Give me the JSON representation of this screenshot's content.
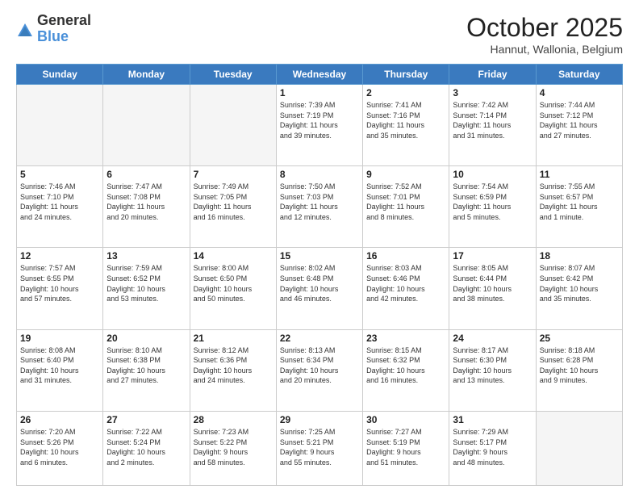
{
  "header": {
    "logo": {
      "general": "General",
      "blue": "Blue"
    },
    "title": "October 2025",
    "location": "Hannut, Wallonia, Belgium"
  },
  "weekdays": [
    "Sunday",
    "Monday",
    "Tuesday",
    "Wednesday",
    "Thursday",
    "Friday",
    "Saturday"
  ],
  "weeks": [
    [
      {
        "day": "",
        "info": ""
      },
      {
        "day": "",
        "info": ""
      },
      {
        "day": "",
        "info": ""
      },
      {
        "day": "1",
        "info": "Sunrise: 7:39 AM\nSunset: 7:19 PM\nDaylight: 11 hours\nand 39 minutes."
      },
      {
        "day": "2",
        "info": "Sunrise: 7:41 AM\nSunset: 7:16 PM\nDaylight: 11 hours\nand 35 minutes."
      },
      {
        "day": "3",
        "info": "Sunrise: 7:42 AM\nSunset: 7:14 PM\nDaylight: 11 hours\nand 31 minutes."
      },
      {
        "day": "4",
        "info": "Sunrise: 7:44 AM\nSunset: 7:12 PM\nDaylight: 11 hours\nand 27 minutes."
      }
    ],
    [
      {
        "day": "5",
        "info": "Sunrise: 7:46 AM\nSunset: 7:10 PM\nDaylight: 11 hours\nand 24 minutes."
      },
      {
        "day": "6",
        "info": "Sunrise: 7:47 AM\nSunset: 7:08 PM\nDaylight: 11 hours\nand 20 minutes."
      },
      {
        "day": "7",
        "info": "Sunrise: 7:49 AM\nSunset: 7:05 PM\nDaylight: 11 hours\nand 16 minutes."
      },
      {
        "day": "8",
        "info": "Sunrise: 7:50 AM\nSunset: 7:03 PM\nDaylight: 11 hours\nand 12 minutes."
      },
      {
        "day": "9",
        "info": "Sunrise: 7:52 AM\nSunset: 7:01 PM\nDaylight: 11 hours\nand 8 minutes."
      },
      {
        "day": "10",
        "info": "Sunrise: 7:54 AM\nSunset: 6:59 PM\nDaylight: 11 hours\nand 5 minutes."
      },
      {
        "day": "11",
        "info": "Sunrise: 7:55 AM\nSunset: 6:57 PM\nDaylight: 11 hours\nand 1 minute."
      }
    ],
    [
      {
        "day": "12",
        "info": "Sunrise: 7:57 AM\nSunset: 6:55 PM\nDaylight: 10 hours\nand 57 minutes."
      },
      {
        "day": "13",
        "info": "Sunrise: 7:59 AM\nSunset: 6:52 PM\nDaylight: 10 hours\nand 53 minutes."
      },
      {
        "day": "14",
        "info": "Sunrise: 8:00 AM\nSunset: 6:50 PM\nDaylight: 10 hours\nand 50 minutes."
      },
      {
        "day": "15",
        "info": "Sunrise: 8:02 AM\nSunset: 6:48 PM\nDaylight: 10 hours\nand 46 minutes."
      },
      {
        "day": "16",
        "info": "Sunrise: 8:03 AM\nSunset: 6:46 PM\nDaylight: 10 hours\nand 42 minutes."
      },
      {
        "day": "17",
        "info": "Sunrise: 8:05 AM\nSunset: 6:44 PM\nDaylight: 10 hours\nand 38 minutes."
      },
      {
        "day": "18",
        "info": "Sunrise: 8:07 AM\nSunset: 6:42 PM\nDaylight: 10 hours\nand 35 minutes."
      }
    ],
    [
      {
        "day": "19",
        "info": "Sunrise: 8:08 AM\nSunset: 6:40 PM\nDaylight: 10 hours\nand 31 minutes."
      },
      {
        "day": "20",
        "info": "Sunrise: 8:10 AM\nSunset: 6:38 PM\nDaylight: 10 hours\nand 27 minutes."
      },
      {
        "day": "21",
        "info": "Sunrise: 8:12 AM\nSunset: 6:36 PM\nDaylight: 10 hours\nand 24 minutes."
      },
      {
        "day": "22",
        "info": "Sunrise: 8:13 AM\nSunset: 6:34 PM\nDaylight: 10 hours\nand 20 minutes."
      },
      {
        "day": "23",
        "info": "Sunrise: 8:15 AM\nSunset: 6:32 PM\nDaylight: 10 hours\nand 16 minutes."
      },
      {
        "day": "24",
        "info": "Sunrise: 8:17 AM\nSunset: 6:30 PM\nDaylight: 10 hours\nand 13 minutes."
      },
      {
        "day": "25",
        "info": "Sunrise: 8:18 AM\nSunset: 6:28 PM\nDaylight: 10 hours\nand 9 minutes."
      }
    ],
    [
      {
        "day": "26",
        "info": "Sunrise: 7:20 AM\nSunset: 5:26 PM\nDaylight: 10 hours\nand 6 minutes."
      },
      {
        "day": "27",
        "info": "Sunrise: 7:22 AM\nSunset: 5:24 PM\nDaylight: 10 hours\nand 2 minutes."
      },
      {
        "day": "28",
        "info": "Sunrise: 7:23 AM\nSunset: 5:22 PM\nDaylight: 9 hours\nand 58 minutes."
      },
      {
        "day": "29",
        "info": "Sunrise: 7:25 AM\nSunset: 5:21 PM\nDaylight: 9 hours\nand 55 minutes."
      },
      {
        "day": "30",
        "info": "Sunrise: 7:27 AM\nSunset: 5:19 PM\nDaylight: 9 hours\nand 51 minutes."
      },
      {
        "day": "31",
        "info": "Sunrise: 7:29 AM\nSunset: 5:17 PM\nDaylight: 9 hours\nand 48 minutes."
      },
      {
        "day": "",
        "info": ""
      }
    ]
  ]
}
